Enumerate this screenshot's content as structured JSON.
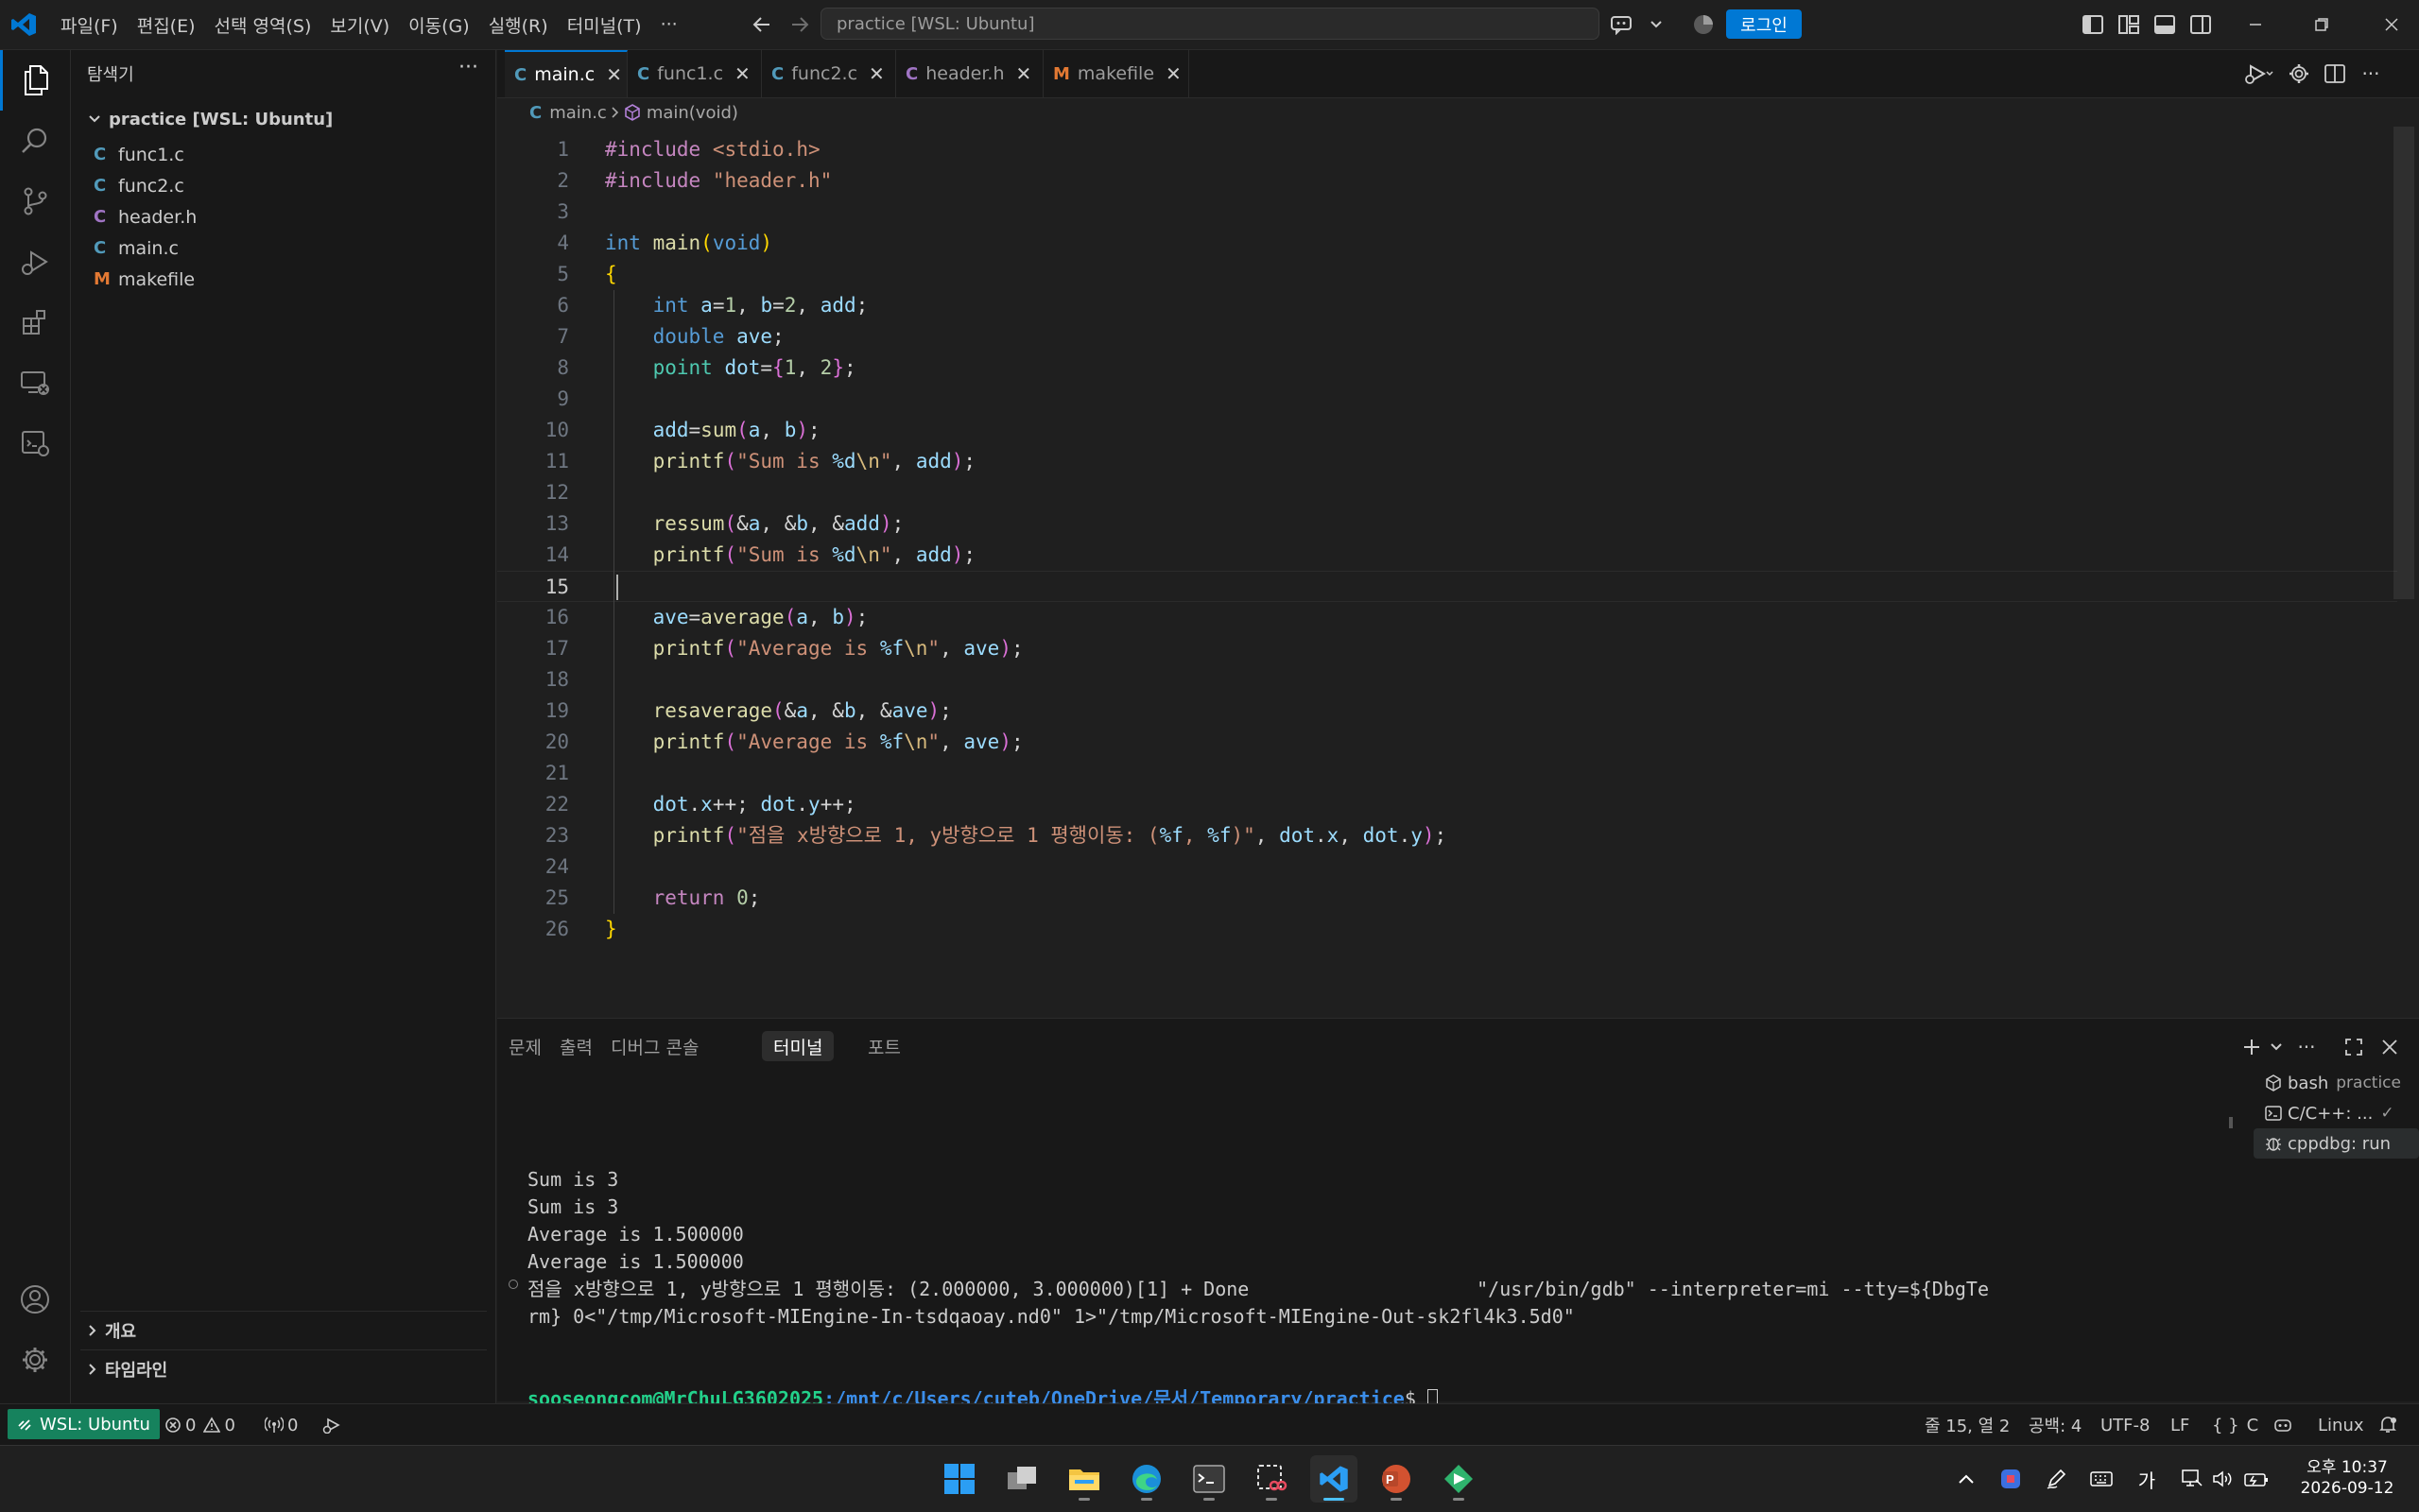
{
  "window": {
    "command_center": "practice [WSL: Ubuntu]",
    "login_label": "로그인",
    "menu": [
      "파일(F)",
      "편집(E)",
      "선택 영역(S)",
      "보기(V)",
      "이동(G)",
      "실행(R)",
      "터미널(T)",
      "···"
    ]
  },
  "sidebar": {
    "title": "탐색기",
    "more": "···",
    "root": "practice [WSL: Ubuntu]",
    "files": [
      {
        "name": "func1.c",
        "icon": "C"
      },
      {
        "name": "func2.c",
        "icon": "C"
      },
      {
        "name": "header.h",
        "icon": "C"
      },
      {
        "name": "main.c",
        "icon": "C"
      },
      {
        "name": "makefile",
        "icon": "M"
      }
    ],
    "outline": "개요",
    "timeline": "타임라인"
  },
  "tabs": [
    {
      "name": "main.c",
      "icon": "C"
    },
    {
      "name": "func1.c",
      "icon": "C"
    },
    {
      "name": "func2.c",
      "icon": "C"
    },
    {
      "name": "header.h",
      "icon": "C"
    },
    {
      "name": "makefile",
      "icon": "M"
    }
  ],
  "breadcrumb": {
    "file": "main.c",
    "symbol": "main(void)"
  },
  "editor": {
    "current_line": 15,
    "lines": [
      "#include <stdio.h>",
      "#include \"header.h\"",
      "",
      "int main(void)",
      "{",
      "    int a=1, b=2, add;",
      "    double ave;",
      "    point dot={1, 2};",
      "",
      "    add=sum(a, b);",
      "    printf(\"Sum is %d\\n\", add);",
      "",
      "    ressum(&a, &b, &add);",
      "    printf(\"Sum is %d\\n\", add);",
      "",
      "    ave=average(a, b);",
      "    printf(\"Average is %f\\n\", ave);",
      "",
      "    resaverage(&a, &b, &ave);",
      "    printf(\"Average is %f\\n\", ave);",
      "",
      "    dot.x++; dot.y++;",
      "    printf(\"점을 x방향으로 1, y방향으로 1 평행이동: (%f, %f)\", dot.x, dot.y);",
      "",
      "    return 0;",
      "}"
    ]
  },
  "panel": {
    "tabs": [
      "문제",
      "출력",
      "디버그 콘솔",
      "터미널",
      "포트"
    ],
    "active_tab": "터미널",
    "terminal_lines": [
      "Sum is 3",
      "Sum is 3",
      "Average is 1.500000",
      "Average is 1.500000",
      "점을 x방향으로 1, y방향으로 1 평행이동: (2.000000, 3.000000)[1] + Done                    \"/usr/bin/gdb\" --interpreter=mi --tty=${DbgTe",
      "rm} 0<\"/tmp/Microsoft-MIEngine-In-tsdqaoay.nd0\" 1>\"/tmp/Microsoft-MIEngine-Out-sk2fl4k3.5d0\""
    ],
    "prompt_user": "sooseongcom@MrChuLG3602025",
    "prompt_path": ":/mnt/c/Users/cuteb/OneDrive/문서/Temporary/practice",
    "prompt_symbol": "$ ",
    "terminals": [
      {
        "name": "bash",
        "sub": "practice"
      },
      {
        "name": "C/C++: ...",
        "sub": "✓"
      },
      {
        "name": "cppdbg: run",
        "sub": ""
      }
    ]
  },
  "statusbar": {
    "remote": "WSL: Ubuntu",
    "errors": "0",
    "warnings": "0",
    "ports": "0",
    "position": "줄 15, 열 2",
    "spaces": "공백: 4",
    "encoding": "UTF-8",
    "eol": "LF",
    "language": "C",
    "os": "Linux"
  },
  "taskbar": {
    "time": "오후 10:37",
    "date": "2026-09-12",
    "ime": "가"
  },
  "colors": {
    "accent": "#0078d4",
    "remote": "#16825d",
    "background": "#1f1f1f"
  },
  "icons": [
    "vscode-logo-icon",
    "explorer-icon",
    "search-icon",
    "source-control-icon",
    "run-debug-icon",
    "extensions-icon",
    "remote-explorer-icon",
    "testing-icon",
    "account-icon",
    "gear-icon"
  ]
}
